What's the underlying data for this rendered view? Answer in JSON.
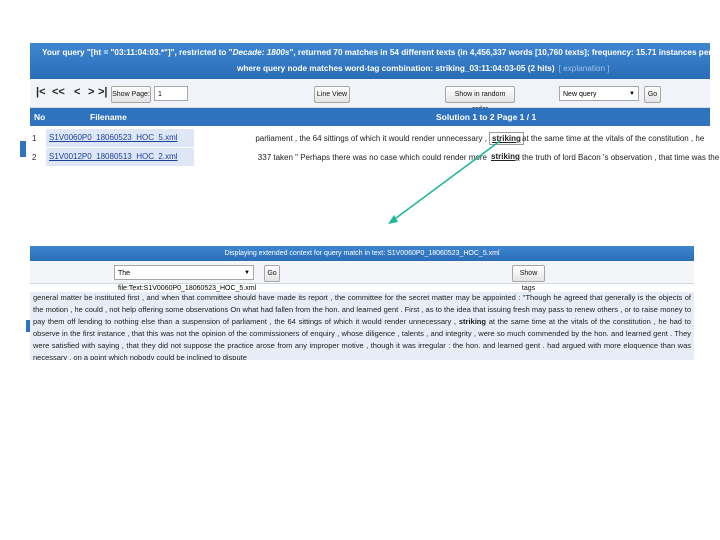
{
  "query": {
    "line1_prefix": "Your query \"[ht = \"03:11:04:03.*\"]\", restricted to \"",
    "line1_restriction": "Decade: 1800s",
    "line1_suffix": "\", returned 70 matches in 54 different texts (in 4,456,337 words [10,760 texts]; frequency: 15.71 instances per million words), redu",
    "line2": "where query node matches word-tag combination: striking_03:11:04:03-05 (2 hits)",
    "line2_hint": "[ explanation ]"
  },
  "nav": {
    "first": "|<",
    "prev_many": "<<",
    "prev": "<",
    "next": ">",
    "next_many": ">|",
    "show_page_label": "Show Page:",
    "page_input_value": "1",
    "line_view_label": "Line View",
    "random_order_label": "Show in random order",
    "new_query_option": "New query",
    "go_label": "Go"
  },
  "results": {
    "headers": {
      "no": "No",
      "filename": "Filename",
      "solution": "Solution 1 to 2",
      "page": "Page 1 / 1"
    },
    "rows": [
      {
        "no": "1",
        "filename": "S1V0060P0_18060523_HOC_5.xml",
        "left": "parliament , the 64 sittings of which it would render unnecessary ,",
        "hit": "striking",
        "right": "at the same time at the vitals of the constitution , he"
      },
      {
        "no": "2",
        "filename": "S1V0012P0_18080513_HOC_2.xml",
        "left": "337 taken \" Perhaps there was no case which could render more",
        "hit": "striking",
        "right": "the truth of lord Bacon 's observation , that time was the"
      }
    ]
  },
  "context": {
    "title": "Displaying extended context for query match in text: S1V0060P0_18060523_HOC_5.xml",
    "file_select": "The file:Text:S1V0060P0_18060523_HOC_5.xml",
    "go_label": "Go",
    "show_tags_label": "Show tags",
    "text_before": "general matter be instituted first , and when that committee should have made its report , the committee for the secret matter may be appointed : \"Though he agreed that generally is the objects of the motion , he could , not help offering some observations On what had fallen from the hon. and learned gent . First , as to the idea that issuing fresh may pass to renew others , or to raise money to pay them off lending to nothing else than a suspension of parliament , the 64 sittings of which it would render unnecessary ,",
    "keyword": "striking",
    "text_after": "at the same time at the vitals of the constitution , he had to observe in the first instance , that this was not the opinion of the commissioners of enquiry , whose diligence , talents , and integrity , were so much commended by the hon. and learned gent . They were satisfied with saying , that they did not suppose the practice arose from any improper motive , though it was irregular : the hon. and learned gent . had argued with more eloquence than was necessary , on a point which nobody could be inclined to dispute"
  },
  "colors": {
    "header_blue": "#2f73bf",
    "row_highlight": "#dde7f5",
    "arrow": "#1fb89a"
  }
}
